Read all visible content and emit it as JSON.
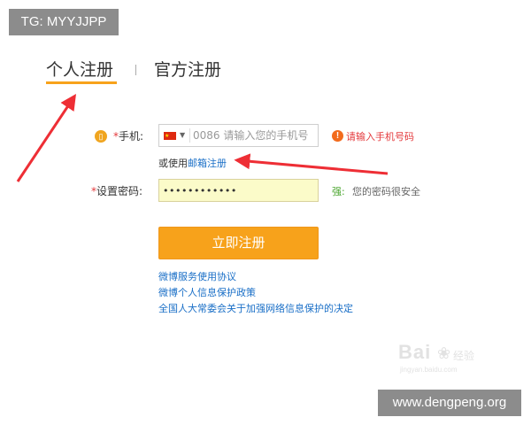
{
  "overlay": {
    "top_left_badge": "TG: MYYJJPP",
    "bottom_right_badge": "www.dengpeng.org"
  },
  "tabs": [
    {
      "label": "个人注册",
      "active": true
    },
    {
      "label": "官方注册",
      "active": false
    }
  ],
  "form": {
    "phone_badge_glyph": "▯",
    "phone_label": "手机:",
    "country_code_glyph": "★",
    "phone_placeholder": "0086 请输入您的手机号",
    "phone_error_icon": "!",
    "phone_error": "请输入手机号码",
    "alt_prefix": "或使用",
    "alt_link": "邮箱注册",
    "password_label": "设置密码:",
    "password_value": "password1234",
    "strength_label": "强:",
    "strength_message": "您的密码很安全",
    "submit_label": "立即注册",
    "required_mark": "*"
  },
  "links": [
    "微博服务使用协议",
    "微博个人信息保护政策",
    "全国人大常委会关于加强网络信息保护的决定"
  ],
  "watermark": {
    "logo_text": "Bai",
    "logo_paw": "❀",
    "logo_sub": "经验",
    "url": "jingyan.baidu.com"
  },
  "colors": {
    "accent": "#f7a21b",
    "error": "#e4393c",
    "link": "#1a6fc7",
    "arrow": "#ee2e35",
    "strength": "#4aa52e",
    "password_bg": "#fbfbc9"
  }
}
